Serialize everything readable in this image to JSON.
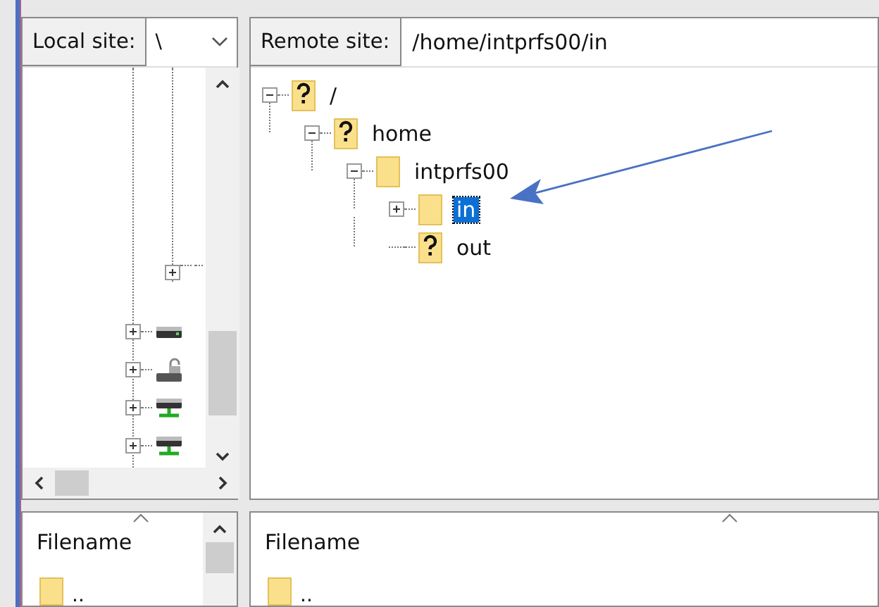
{
  "local_site": {
    "label": "Local site:",
    "value": "\\"
  },
  "local_tree": [
    {
      "kind": "blank",
      "expanded": false,
      "nested": true
    },
    {
      "kind": "drive",
      "expanded": false,
      "nested": false
    },
    {
      "kind": "locked-drive",
      "expanded": false,
      "nested": false
    },
    {
      "kind": "network-drive",
      "expanded": false,
      "nested": false
    },
    {
      "kind": "network-drive",
      "expanded": false,
      "nested": false
    }
  ],
  "remote_site": {
    "label": "Remote site:",
    "value": "/home/intprfs00/in"
  },
  "remote_tree": [
    {
      "name": "/",
      "kind": "unknown",
      "expanded": true,
      "selected": false,
      "children": [
        {
          "name": "home",
          "kind": "unknown",
          "expanded": true,
          "selected": false,
          "children": [
            {
              "name": "intprfs00",
              "kind": "folder",
              "expanded": true,
              "selected": false,
              "children": [
                {
                  "name": "in",
                  "kind": "folder",
                  "expanded": false,
                  "selected": true
                },
                {
                  "name": "out",
                  "kind": "unknown",
                  "selected": false
                }
              ]
            }
          ]
        }
      ]
    }
  ],
  "local_files": {
    "columns": [
      "Filename"
    ],
    "rows": [
      ".."
    ]
  },
  "remote_files": {
    "columns": [
      "Filename"
    ],
    "rows": [
      ".."
    ]
  }
}
